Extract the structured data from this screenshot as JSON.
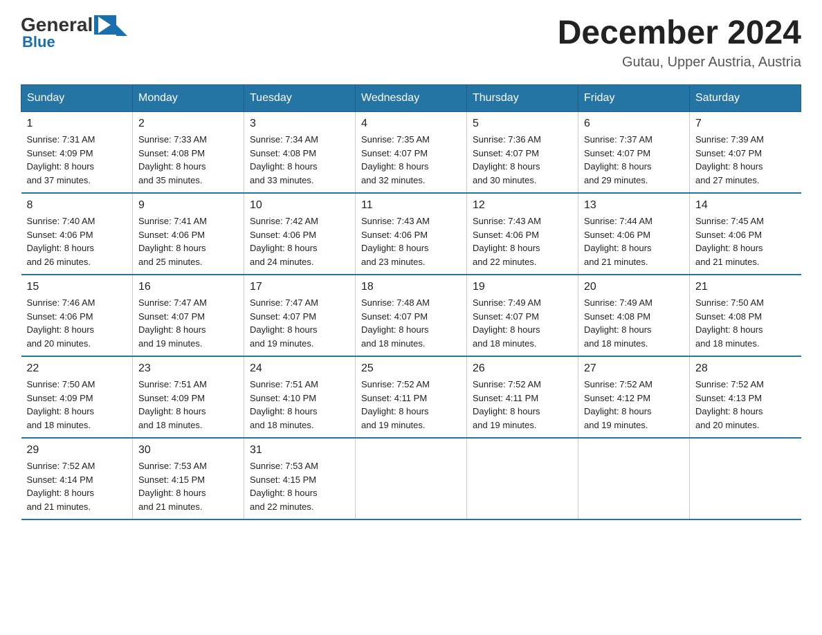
{
  "logo": {
    "general": "General",
    "blue": "Blue"
  },
  "title": "December 2024",
  "location": "Gutau, Upper Austria, Austria",
  "days_of_week": [
    "Sunday",
    "Monday",
    "Tuesday",
    "Wednesday",
    "Thursday",
    "Friday",
    "Saturday"
  ],
  "weeks": [
    [
      {
        "day": "1",
        "sunrise": "7:31 AM",
        "sunset": "4:09 PM",
        "daylight": "8 hours and 37 minutes."
      },
      {
        "day": "2",
        "sunrise": "7:33 AM",
        "sunset": "4:08 PM",
        "daylight": "8 hours and 35 minutes."
      },
      {
        "day": "3",
        "sunrise": "7:34 AM",
        "sunset": "4:08 PM",
        "daylight": "8 hours and 33 minutes."
      },
      {
        "day": "4",
        "sunrise": "7:35 AM",
        "sunset": "4:07 PM",
        "daylight": "8 hours and 32 minutes."
      },
      {
        "day": "5",
        "sunrise": "7:36 AM",
        "sunset": "4:07 PM",
        "daylight": "8 hours and 30 minutes."
      },
      {
        "day": "6",
        "sunrise": "7:37 AM",
        "sunset": "4:07 PM",
        "daylight": "8 hours and 29 minutes."
      },
      {
        "day": "7",
        "sunrise": "7:39 AM",
        "sunset": "4:07 PM",
        "daylight": "8 hours and 27 minutes."
      }
    ],
    [
      {
        "day": "8",
        "sunrise": "7:40 AM",
        "sunset": "4:06 PM",
        "daylight": "8 hours and 26 minutes."
      },
      {
        "day": "9",
        "sunrise": "7:41 AM",
        "sunset": "4:06 PM",
        "daylight": "8 hours and 25 minutes."
      },
      {
        "day": "10",
        "sunrise": "7:42 AM",
        "sunset": "4:06 PM",
        "daylight": "8 hours and 24 minutes."
      },
      {
        "day": "11",
        "sunrise": "7:43 AM",
        "sunset": "4:06 PM",
        "daylight": "8 hours and 23 minutes."
      },
      {
        "day": "12",
        "sunrise": "7:43 AM",
        "sunset": "4:06 PM",
        "daylight": "8 hours and 22 minutes."
      },
      {
        "day": "13",
        "sunrise": "7:44 AM",
        "sunset": "4:06 PM",
        "daylight": "8 hours and 21 minutes."
      },
      {
        "day": "14",
        "sunrise": "7:45 AM",
        "sunset": "4:06 PM",
        "daylight": "8 hours and 21 minutes."
      }
    ],
    [
      {
        "day": "15",
        "sunrise": "7:46 AM",
        "sunset": "4:06 PM",
        "daylight": "8 hours and 20 minutes."
      },
      {
        "day": "16",
        "sunrise": "7:47 AM",
        "sunset": "4:07 PM",
        "daylight": "8 hours and 19 minutes."
      },
      {
        "day": "17",
        "sunrise": "7:47 AM",
        "sunset": "4:07 PM",
        "daylight": "8 hours and 19 minutes."
      },
      {
        "day": "18",
        "sunrise": "7:48 AM",
        "sunset": "4:07 PM",
        "daylight": "8 hours and 18 minutes."
      },
      {
        "day": "19",
        "sunrise": "7:49 AM",
        "sunset": "4:07 PM",
        "daylight": "8 hours and 18 minutes."
      },
      {
        "day": "20",
        "sunrise": "7:49 AM",
        "sunset": "4:08 PM",
        "daylight": "8 hours and 18 minutes."
      },
      {
        "day": "21",
        "sunrise": "7:50 AM",
        "sunset": "4:08 PM",
        "daylight": "8 hours and 18 minutes."
      }
    ],
    [
      {
        "day": "22",
        "sunrise": "7:50 AM",
        "sunset": "4:09 PM",
        "daylight": "8 hours and 18 minutes."
      },
      {
        "day": "23",
        "sunrise": "7:51 AM",
        "sunset": "4:09 PM",
        "daylight": "8 hours and 18 minutes."
      },
      {
        "day": "24",
        "sunrise": "7:51 AM",
        "sunset": "4:10 PM",
        "daylight": "8 hours and 18 minutes."
      },
      {
        "day": "25",
        "sunrise": "7:52 AM",
        "sunset": "4:11 PM",
        "daylight": "8 hours and 19 minutes."
      },
      {
        "day": "26",
        "sunrise": "7:52 AM",
        "sunset": "4:11 PM",
        "daylight": "8 hours and 19 minutes."
      },
      {
        "day": "27",
        "sunrise": "7:52 AM",
        "sunset": "4:12 PM",
        "daylight": "8 hours and 19 minutes."
      },
      {
        "day": "28",
        "sunrise": "7:52 AM",
        "sunset": "4:13 PM",
        "daylight": "8 hours and 20 minutes."
      }
    ],
    [
      {
        "day": "29",
        "sunrise": "7:52 AM",
        "sunset": "4:14 PM",
        "daylight": "8 hours and 21 minutes."
      },
      {
        "day": "30",
        "sunrise": "7:53 AM",
        "sunset": "4:15 PM",
        "daylight": "8 hours and 21 minutes."
      },
      {
        "day": "31",
        "sunrise": "7:53 AM",
        "sunset": "4:15 PM",
        "daylight": "8 hours and 22 minutes."
      },
      null,
      null,
      null,
      null
    ]
  ],
  "labels": {
    "sunrise": "Sunrise:",
    "sunset": "Sunset:",
    "daylight": "Daylight:"
  }
}
